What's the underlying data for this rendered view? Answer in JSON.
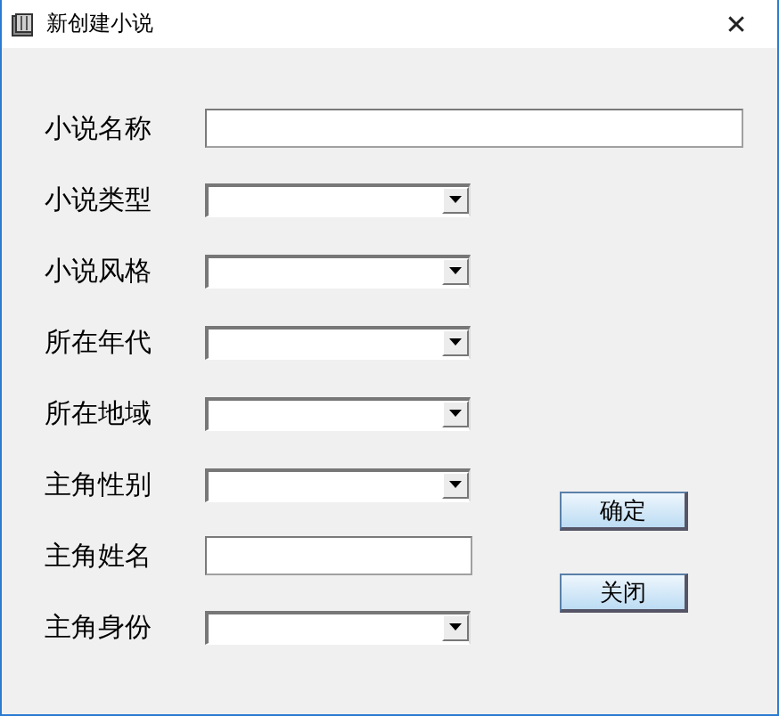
{
  "window": {
    "title": "新创建小说",
    "close": "✕"
  },
  "fields": [
    {
      "label": "小说名称",
      "kind": "text"
    },
    {
      "label": "小说类型",
      "kind": "select"
    },
    {
      "label": "小说风格",
      "kind": "select"
    },
    {
      "label": "所在年代",
      "kind": "select"
    },
    {
      "label": "所在地域",
      "kind": "select"
    },
    {
      "label": "主角性别",
      "kind": "select"
    },
    {
      "label": "主角姓名",
      "kind": "text"
    },
    {
      "label": "主角身份",
      "kind": "select"
    }
  ],
  "buttons": [
    "确定",
    "关闭"
  ]
}
